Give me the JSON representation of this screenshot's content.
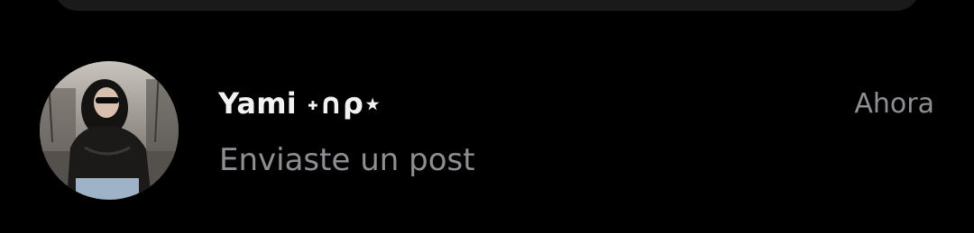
{
  "conversation": {
    "name": "Yami ˖∩ρ⋆",
    "last_message": "Enviaste un post",
    "time": "Ahora"
  }
}
